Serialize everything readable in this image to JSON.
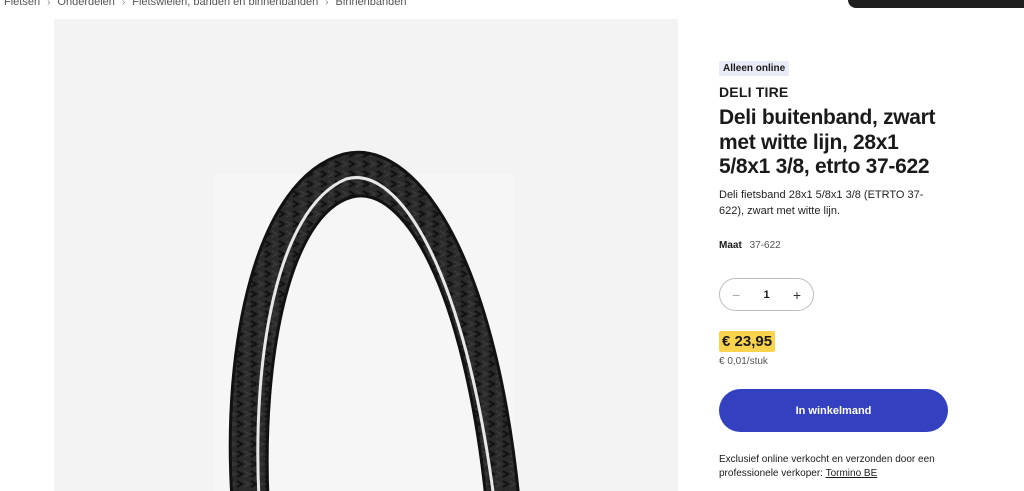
{
  "breadcrumb": [
    "Fietsen",
    "Onderdelen",
    "Fietswielen, banden en binnenbanden",
    "Binnenbanden"
  ],
  "product": {
    "badge": "Alleen online",
    "brand": "DELI TIRE",
    "title": "Deli buitenband, zwart met witte lijn, 28x1 5/8x1 3/8, etrto 37-622",
    "description": "Deli fietsband 28x1 5/8x1 3/8 (ETRTO 37-622), zwart met witte lijn.",
    "size_label": "Maat",
    "size_value": "37-622",
    "quantity": "1",
    "price": "€ 23,95",
    "unit_price": "€ 0,01/stuk",
    "cart_button": "In winkelmand",
    "seller_text": "Exclusief online verkocht en verzonden door een professionele verkoper:",
    "seller_name": "Tormino BE"
  },
  "icons": {
    "separator": "chevron-right-icon",
    "minus": "minus-icon",
    "plus": "plus-icon"
  },
  "colors": {
    "accent": "#3340c0",
    "price_highlight": "#fbd34d",
    "badge_bg": "#e8eaf5"
  }
}
